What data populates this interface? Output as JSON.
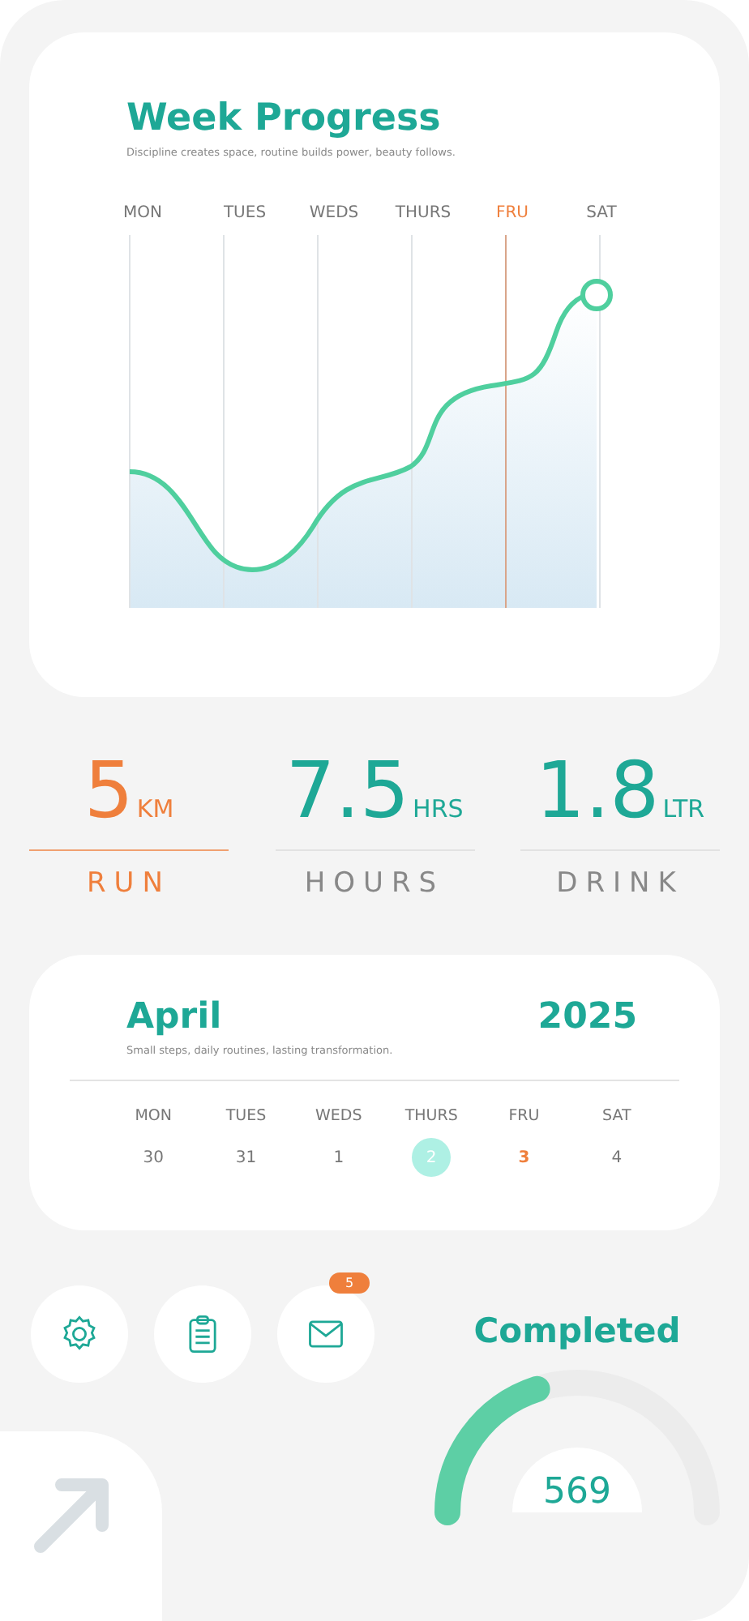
{
  "week_progress": {
    "title": "Week Progress",
    "subtitle": "Discipline creates space, routine builds power, beauty follows.",
    "days": [
      {
        "label": "MON",
        "selected": false
      },
      {
        "label": "TUES",
        "selected": false
      },
      {
        "label": "WEDS",
        "selected": false
      },
      {
        "label": "THURS",
        "selected": false
      },
      {
        "label": "FRU",
        "selected": true
      },
      {
        "label": "SAT",
        "selected": false
      }
    ]
  },
  "stats": [
    {
      "value": "5",
      "unit": "KM",
      "label": "RUN",
      "selected": true
    },
    {
      "value": "7.5",
      "unit": "HRS",
      "label": "HOURS",
      "selected": false
    },
    {
      "value": "1.8",
      "unit": "LTR",
      "label": "DRINK",
      "selected": false
    }
  ],
  "calendar": {
    "month": "April",
    "year": "2025",
    "subtitle": "Small steps, daily routines, lasting transformation.",
    "days": [
      {
        "label": "MON",
        "date": "30",
        "today": false,
        "selected": false
      },
      {
        "label": "TUES",
        "date": "31",
        "today": false,
        "selected": false
      },
      {
        "label": "WEDS",
        "date": "1",
        "today": false,
        "selected": false
      },
      {
        "label": "THURS",
        "date": "2",
        "today": true,
        "selected": false
      },
      {
        "label": "FRU",
        "date": "3",
        "today": false,
        "selected": true
      },
      {
        "label": "SAT",
        "date": "4",
        "today": false,
        "selected": false
      }
    ]
  },
  "actions": [
    {
      "kind": "settings"
    },
    {
      "kind": "clipboard"
    },
    {
      "kind": "mail",
      "badge": "5"
    }
  ],
  "completed": {
    "title": "Completed",
    "value": "569"
  }
}
